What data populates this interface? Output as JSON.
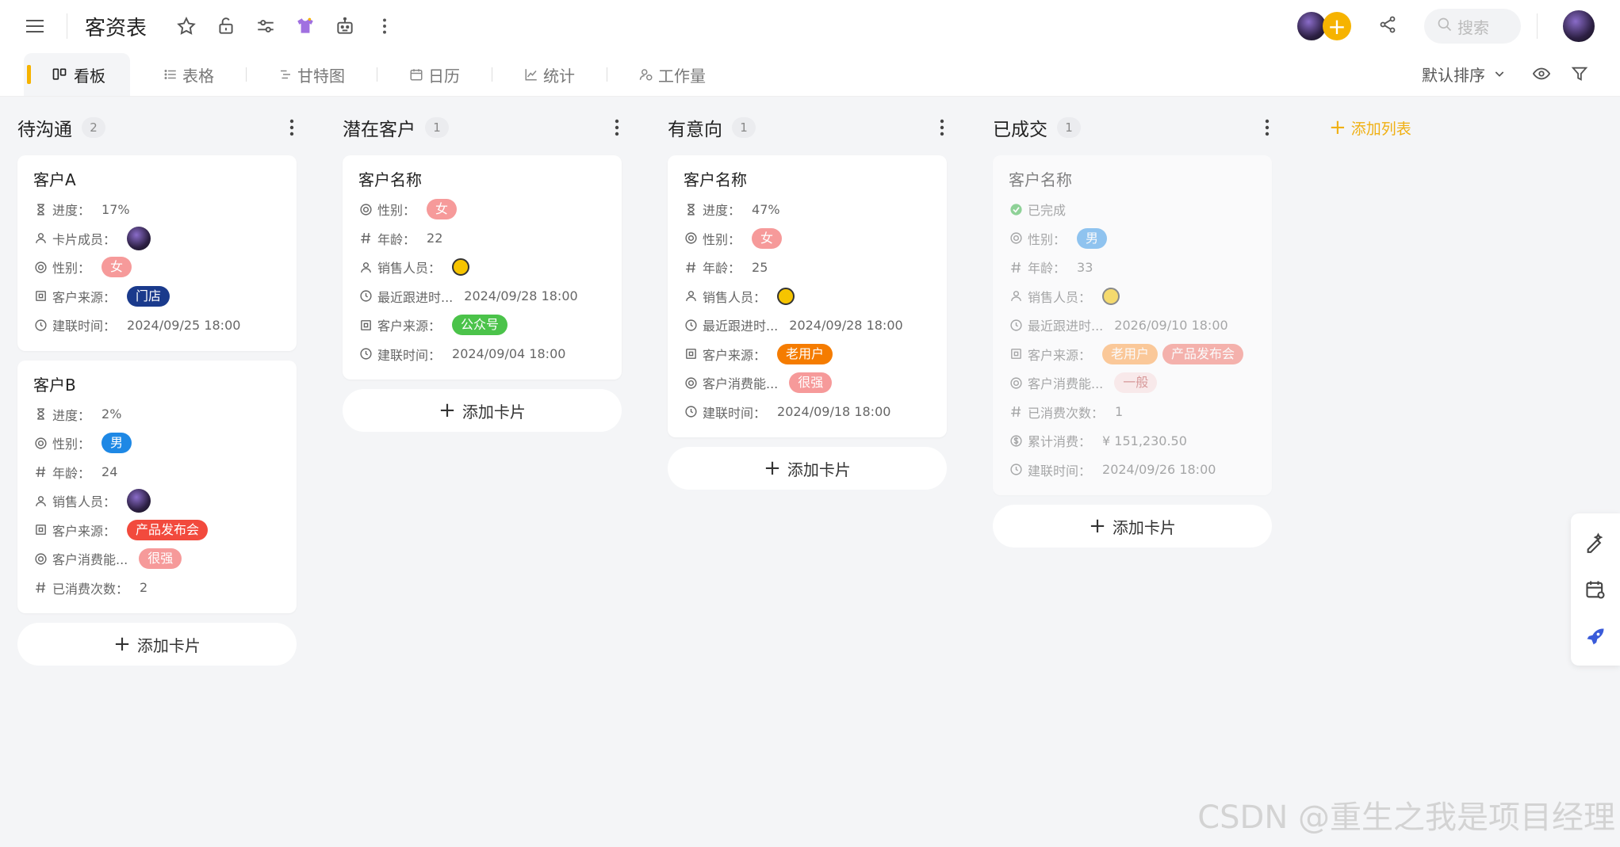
{
  "header": {
    "title": "客资表",
    "search_placeholder": "搜索"
  },
  "tabs": {
    "active": {
      "icon": "kanban-icon",
      "label": "看板"
    },
    "items": [
      {
        "icon": "list-icon",
        "label": "表格"
      },
      {
        "icon": "gantt-icon",
        "label": "甘特图"
      },
      {
        "icon": "calendar-icon",
        "label": "日历"
      },
      {
        "icon": "chart-line-icon",
        "label": "统计"
      },
      {
        "icon": "workload-icon",
        "label": "工作量"
      }
    ],
    "sort_label": "默认排序"
  },
  "board": {
    "add_list_label": "添加列表",
    "add_card_label": "添加卡片",
    "columns": [
      {
        "title": "待沟通",
        "count": "2",
        "cards": [
          {
            "title": "客户A",
            "fields": [
              {
                "icon": "hourglass-icon",
                "label": "进度：",
                "value": "17%"
              },
              {
                "icon": "user-icon",
                "label": "卡片成员：",
                "avatar": true
              },
              {
                "icon": "target-icon",
                "label": "性别：",
                "tags": [
                  {
                    "text": "女",
                    "style": "pink"
                  }
                ]
              },
              {
                "icon": "square-icon",
                "label": "客户来源：",
                "tags": [
                  {
                    "text": "门店",
                    "style": "navy"
                  }
                ]
              },
              {
                "icon": "clock-icon",
                "label": "建联时间：",
                "value": "2024/09/25 18:00"
              }
            ]
          },
          {
            "title": "客户B",
            "fields": [
              {
                "icon": "hourglass-icon",
                "label": "进度：",
                "value": "2%"
              },
              {
                "icon": "target-icon",
                "label": "性别：",
                "tags": [
                  {
                    "text": "男",
                    "style": "blue"
                  }
                ]
              },
              {
                "icon": "hash-icon",
                "label": "年龄：",
                "value": "24"
              },
              {
                "icon": "user-icon",
                "label": "销售人员：",
                "avatar": true
              },
              {
                "icon": "square-icon",
                "label": "客户来源：",
                "tags": [
                  {
                    "text": "产品发布会",
                    "style": "red"
                  }
                ]
              },
              {
                "icon": "target-icon",
                "label": "客户消费能...",
                "tags": [
                  {
                    "text": "很强",
                    "style": "pink"
                  }
                ]
              },
              {
                "icon": "hash-icon",
                "label": "已消费次数：",
                "value": "2"
              }
            ]
          }
        ]
      },
      {
        "title": "潜在客户",
        "count": "1",
        "cards": [
          {
            "title": "客户名称",
            "fields": [
              {
                "icon": "target-icon",
                "label": "性别：",
                "tags": [
                  {
                    "text": "女",
                    "style": "pink"
                  }
                ]
              },
              {
                "icon": "hash-icon",
                "label": "年龄：",
                "value": "22"
              },
              {
                "icon": "user-icon",
                "label": "销售人员：",
                "coin": true
              },
              {
                "icon": "clock-icon",
                "label": "最近跟进时...",
                "value": "2024/09/28 18:00"
              },
              {
                "icon": "square-icon",
                "label": "客户来源：",
                "tags": [
                  {
                    "text": "公众号",
                    "style": "green"
                  }
                ]
              },
              {
                "icon": "clock-icon",
                "label": "建联时间：",
                "value": "2024/09/04 18:00"
              }
            ]
          }
        ]
      },
      {
        "title": "有意向",
        "count": "1",
        "cards": [
          {
            "title": "客户名称",
            "fields": [
              {
                "icon": "hourglass-icon",
                "label": "进度：",
                "value": "47%"
              },
              {
                "icon": "target-icon",
                "label": "性别：",
                "tags": [
                  {
                    "text": "女",
                    "style": "pink"
                  }
                ]
              },
              {
                "icon": "hash-icon",
                "label": "年龄：",
                "value": "25"
              },
              {
                "icon": "user-icon",
                "label": "销售人员：",
                "coin": true
              },
              {
                "icon": "clock-icon",
                "label": "最近跟进时...",
                "value": "2024/09/28 18:00"
              },
              {
                "icon": "square-icon",
                "label": "客户来源：",
                "tags": [
                  {
                    "text": "老用户",
                    "style": "orange"
                  }
                ]
              },
              {
                "icon": "target-icon",
                "label": "客户消费能...",
                "tags": [
                  {
                    "text": "很强",
                    "style": "pink"
                  }
                ]
              },
              {
                "icon": "clock-icon",
                "label": "建联时间：",
                "value": "2024/09/18 18:00"
              }
            ]
          }
        ]
      },
      {
        "title": "已成交",
        "count": "1",
        "cards": [
          {
            "title": "客户名称",
            "faded": true,
            "status": "已完成",
            "fields": [
              {
                "icon": "target-icon",
                "label": "性别：",
                "tags": [
                  {
                    "text": "男",
                    "style": "lightblue"
                  }
                ]
              },
              {
                "icon": "hash-icon",
                "label": "年龄：",
                "value": "33"
              },
              {
                "icon": "user-icon",
                "label": "销售人员：",
                "coin": true
              },
              {
                "icon": "clock-icon",
                "label": "最近跟进时...",
                "value": "2026/09/10 18:00"
              },
              {
                "icon": "square-icon",
                "label": "客户来源：",
                "tags": [
                  {
                    "text": "老用户",
                    "style": "softorange"
                  },
                  {
                    "text": "产品发布会",
                    "style": "softred"
                  }
                ]
              },
              {
                "icon": "target-icon",
                "label": "客户消费能...",
                "tags": [
                  {
                    "text": "一般",
                    "style": "pale"
                  }
                ]
              },
              {
                "icon": "hash-icon",
                "label": "已消费次数：",
                "value": "1"
              },
              {
                "icon": "dollar-icon",
                "label": "累计消费：",
                "value": "¥ 151,230.50"
              },
              {
                "icon": "clock-icon",
                "label": "建联时间：",
                "value": "2024/09/26 18:00"
              }
            ]
          }
        ]
      }
    ]
  },
  "watermark": "CSDN @重生之我是项目经理",
  "colors": {
    "accent": "#f6b300",
    "blue_accent": "#3a5bd9"
  }
}
